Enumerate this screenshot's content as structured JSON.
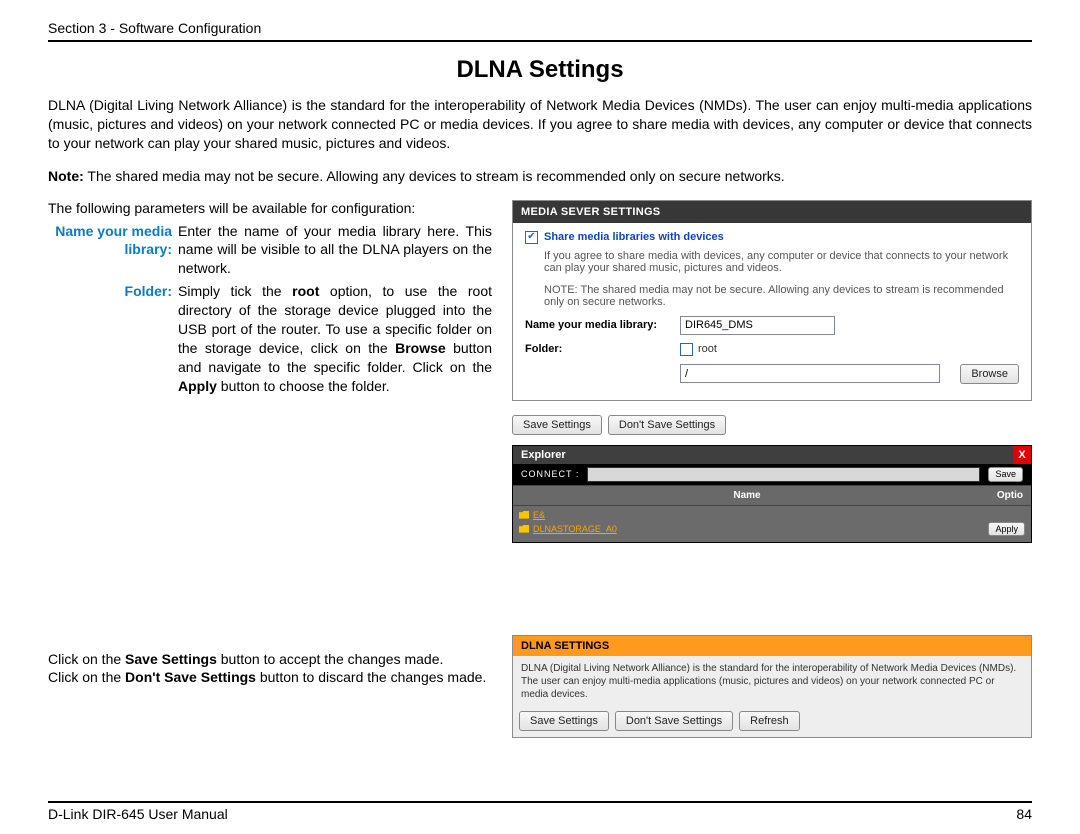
{
  "header": {
    "section": "Section 3 - Software Configuration"
  },
  "title": "DLNA Settings",
  "intro": {
    "p1": "DLNA (Digital Living Network Alliance) is the standard for the interoperability of Network Media Devices (NMDs). The user can enjoy multi-media applications (music, pictures and videos) on your network connected PC or media devices. If you agree to share media with devices, any computer or device that connects to your network can play your shared music, pictures and videos.",
    "note_label": "Note:",
    "note": "The shared media may not be secure. Allowing any devices to stream is recommended only on secure networks."
  },
  "config_lead": "The following parameters will be available for configuration:",
  "params": {
    "name_label": "Name your media library:",
    "name_desc": "Enter the name of your media library here. This name will be visible to all the DLNA players on the network.",
    "folder_label": "Folder:",
    "folder_desc_a": "Simply tick the ",
    "folder_root": "root",
    "folder_desc_b": " option, to use the root directory of the storage device plugged into the USB port of the router. To use a specific folder on the storage device, click on the ",
    "folder_browse": "Browse",
    "folder_desc_c": " button and navigate to the specific folder. Click on the ",
    "folder_apply": "Apply",
    "folder_desc_d": " button to choose the folder."
  },
  "media_panel": {
    "title": "MEDIA SEVER SETTINGS",
    "share_label": "Share media libraries with devices",
    "share_sub": "If you agree to share media with devices, any computer or device that connects to your network can play your shared music, pictures and videos.",
    "share_note": "NOTE: The shared media may not be secure. Allowing any devices to stream is recommended only on secure networks.",
    "name_label": "Name your media library:",
    "name_value": "DIR645_DMS",
    "folder_label": "Folder:",
    "root_label": "root",
    "path_value": "/",
    "browse_btn": "Browse",
    "save_btn": "Save Settings",
    "dontsave_btn": "Don't Save Settings"
  },
  "explorer": {
    "title": "Explorer",
    "connect_label": "CONNECT :",
    "save_btn": "Save",
    "col_name": "Name",
    "col_opt": "Optio",
    "row1": "E&",
    "row2": "DLNASTORAGE_A0",
    "apply_btn": "Apply"
  },
  "dlna_panel": {
    "title": "DLNA SETTINGS",
    "body": "DLNA (Digital Living Network Alliance) is the standard for the interoperability of Network Media Devices (NMDs). The user can enjoy multi-media applications (music, pictures and videos) on your network connected PC or media devices.",
    "save_btn": "Save Settings",
    "dontsave_btn": "Don't Save Settings",
    "refresh_btn": "Refresh"
  },
  "savelines": {
    "l1a": "Click on the ",
    "l1b": "Save Settings",
    "l1c": " button to accept the changes made.",
    "l2a": "Click on the ",
    "l2b": "Don't Save Settings",
    "l2c": " button to discard the changes made."
  },
  "footer": {
    "left": "D-Link DIR-645 User Manual",
    "right": "84"
  }
}
